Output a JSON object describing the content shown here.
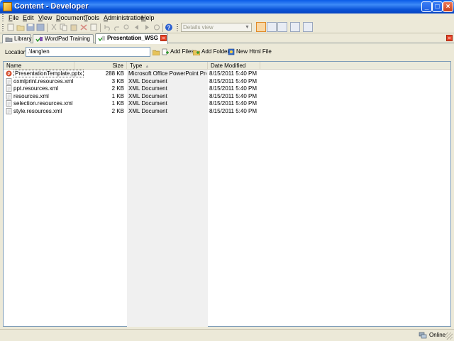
{
  "window": {
    "title": "Content - Developer"
  },
  "menu": [
    {
      "label": "File",
      "u": "F",
      "rest": "ile"
    },
    {
      "label": "Edit",
      "u": "E",
      "rest": "dit"
    },
    {
      "label": "View",
      "u": "V",
      "rest": "iew"
    },
    {
      "label": "Document",
      "u": "D",
      "rest": "ocument"
    },
    {
      "label": "Tools",
      "u": "T",
      "rest": "ools"
    },
    {
      "label": "Administration",
      "u": "A",
      "rest": "dministration"
    },
    {
      "label": "Help",
      "u": "H",
      "rest": "elp"
    }
  ],
  "toolbar": {
    "view_mode": "Details view"
  },
  "tabs": [
    {
      "label": "Library",
      "selected": false
    },
    {
      "label": "WordPad Training",
      "selected": false
    },
    {
      "label": "Presentation_WSG",
      "selected": true
    }
  ],
  "location": {
    "label": "Location:",
    "path": ".\\lang\\en",
    "actions": [
      "Add Files",
      "Add Folder",
      "New Html File"
    ]
  },
  "columns": [
    "Name",
    "Size",
    "Type",
    "Date Modified"
  ],
  "files": [
    {
      "name": "PresentationTemplate.pptx",
      "size": "288 KB",
      "type": "Microsoft Office PowerPoint Pres...",
      "date": "8/15/2011 5:40 PM"
    },
    {
      "name": "oxmlprint.resources.xml",
      "size": "3 KB",
      "type": "XML Document",
      "date": "8/15/2011 5:40 PM"
    },
    {
      "name": "ppt.resources.xml",
      "size": "2 KB",
      "type": "XML Document",
      "date": "8/15/2011 5:40 PM"
    },
    {
      "name": "resources.xml",
      "size": "1 KB",
      "type": "XML Document",
      "date": "8/15/2011 5:40 PM"
    },
    {
      "name": "selection.resources.xml",
      "size": "1 KB",
      "type": "XML Document",
      "date": "8/15/2011 5:40 PM"
    },
    {
      "name": "style.resources.xml",
      "size": "2 KB",
      "type": "XML Document",
      "date": "8/15/2011 5:40 PM"
    }
  ],
  "status": {
    "connection": "Online"
  },
  "colors": {
    "titlebar": "#0a5ce8",
    "sort_column": "#f0f0f0",
    "selected_view": "#f9d7a4"
  }
}
